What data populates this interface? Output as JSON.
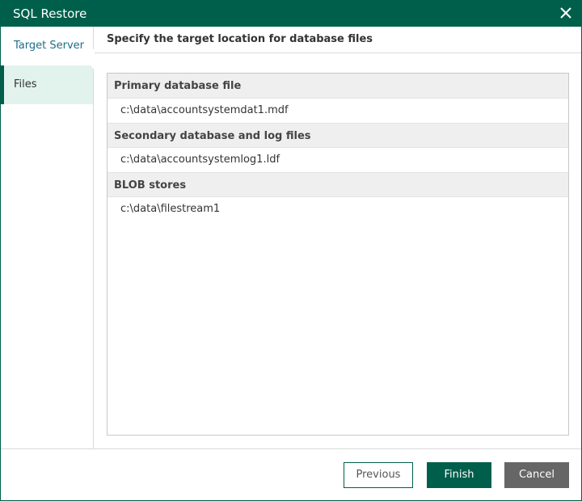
{
  "window": {
    "title": "SQL Restore",
    "close_icon": "close-icon",
    "accent_color": "#005f4b"
  },
  "sidebar": {
    "items": [
      {
        "label": "Target Server",
        "active": false
      },
      {
        "label": "Files",
        "active": true
      }
    ]
  },
  "main": {
    "header": "Specify the target location for database files",
    "groups": [
      {
        "title": "Primary database file",
        "files": [
          "c:\\data\\accountsystemdat1.mdf"
        ]
      },
      {
        "title": "Secondary database and log files",
        "files": [
          "c:\\data\\accountsystemlog1.ldf"
        ]
      },
      {
        "title": "BLOB stores",
        "files": [
          "c:\\data\\filestream1"
        ]
      }
    ]
  },
  "footer": {
    "previous_label": "Previous",
    "finish_label": "Finish",
    "cancel_label": "Cancel"
  }
}
